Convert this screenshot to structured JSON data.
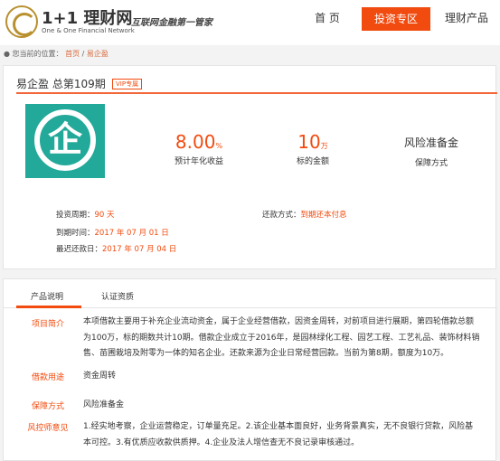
{
  "header": {
    "brand_cn": "1+1 理财网",
    "brand_en": "One & One Financial Network",
    "slogan": "互联网金融第一管家",
    "nav": {
      "home": "首 页",
      "invest": "投资专区",
      "products": "理财产品"
    }
  },
  "breadcrumb": {
    "prefix": "您当前的位置：",
    "home": "首页",
    "separator": "/",
    "current": "易企盈"
  },
  "product": {
    "title": "易企盈 总第109期",
    "tag": "VIP专属",
    "icon_char": "企",
    "rate_value": "8.00",
    "rate_unit": "%",
    "rate_caption": "预计年化收益",
    "amount_value": "10",
    "amount_unit": "万",
    "amount_caption": "标的金额",
    "guarantee_value": "风险准备金",
    "guarantee_caption": "保障方式",
    "period_label": "投资周期：",
    "period_value": "90 天",
    "due_label": "到期时间：",
    "due_value": "2017 年 07 月 01 日",
    "last_label": "最迟还款日：",
    "last_value": "2017 年 07 月 04 日",
    "repay_label": "还款方式：",
    "repay_value": "到期还本付息"
  },
  "details": {
    "tabs": [
      "产品说明",
      "认证资质"
    ],
    "rows": [
      {
        "label": "项目简介",
        "text": "本项借款主要用于补充企业流动资金，属于企业经营借款，因资金周转，对前项目进行展期，第四轮借款总额为100万，标的期数共计10期。借款企业成立于2016年，是园林绿化工程、园艺工程、工艺礼品、装饰材料销售、苗圃栽培及附零为一体的知名企业。还款来源为企业日常经营回款。当前为第8期，额度为10万。"
      },
      {
        "label": "借款用途",
        "text": "资金周转"
      },
      {
        "label": "保障方式",
        "text": "风险准备金"
      },
      {
        "label": "风控师意见",
        "text": "1.经实地考察，企业运营稳定，订单量充足。2.该企业基本面良好，业务背景真实，无不良银行贷款，风险基本可控。3.有优质应收款供质押。4.企业及法人增信查无不良记录审核通过。"
      }
    ]
  }
}
